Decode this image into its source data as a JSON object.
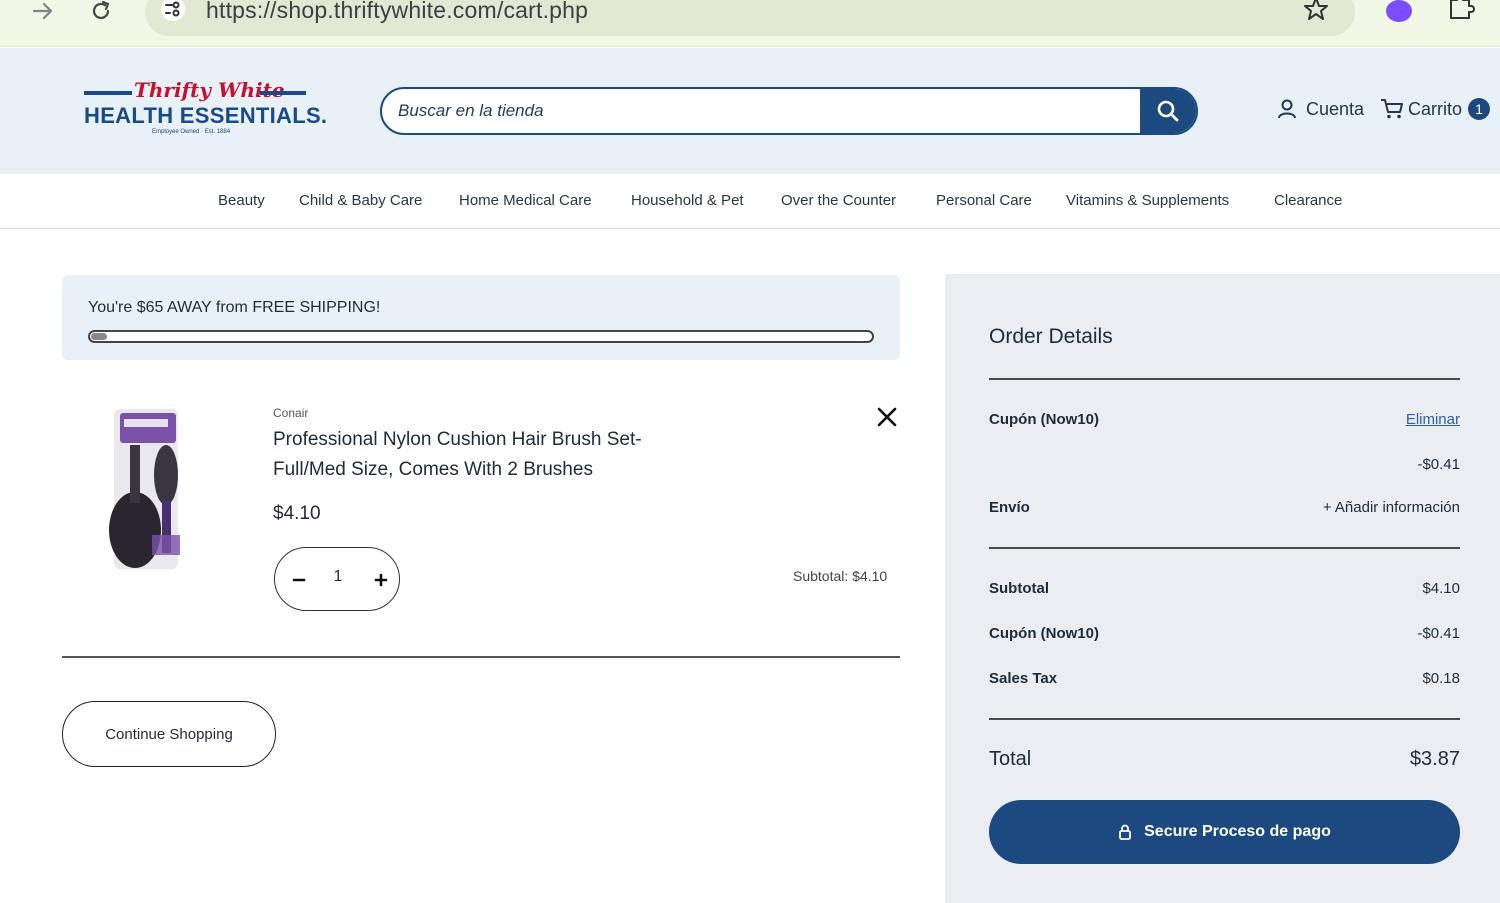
{
  "browser": {
    "url": "https://shop.thriftywhite.com/cart.php",
    "forward_icon": "arrow-right-icon",
    "reload_icon": "reload-icon"
  },
  "header": {
    "logo_script": "Thrifty White",
    "logo_main": "HEALTH ESSENTIALS.",
    "logo_tag": "Employee Owned · Est. 1884",
    "search_placeholder": "Buscar en la tienda",
    "account_label": "Cuenta",
    "cart_label": "Carrito",
    "cart_count": "1"
  },
  "categories": [
    "Beauty",
    "Child & Baby Care",
    "Home Medical Care",
    "Household & Pet",
    "Over the Counter",
    "Personal Care",
    "Vitamins & Supplements",
    "Clearance"
  ],
  "shipping": {
    "message": "You're $65 AWAY from FREE SHIPPING!",
    "progress_fraction": 0.02
  },
  "item": {
    "brand": "Conair",
    "title": "Professional Nylon Cushion Hair Brush Set-Full/Med Size, Comes With 2 Brushes",
    "price": "$4.10",
    "quantity": "1",
    "subtotal_label": "Subtotal:",
    "subtotal_value": "$4.10"
  },
  "continue_label": "Continue Shopping",
  "summary": {
    "title": "Order Details",
    "coupon_label": "Cupón (Now10)",
    "coupon_remove": "Eliminar",
    "coupon_discount": "-$0.41",
    "shipping_label": "Envío",
    "shipping_action": "+ Añadir información",
    "subtotal_label": "Subtotal",
    "subtotal_value": "$4.10",
    "coupon2_label": "Cupón (Now10)",
    "coupon2_value": "-$0.41",
    "tax_label": "Sales Tax",
    "tax_value": "$0.18",
    "total_label": "Total",
    "total_value": "$3.87",
    "checkout_label": "Secure Proceso de pago"
  },
  "colors": {
    "brand_blue": "#1c4a80",
    "logo_red": "#c8102e",
    "header_bg": "#e8f0f8",
    "summary_bg": "#eaeef2"
  }
}
